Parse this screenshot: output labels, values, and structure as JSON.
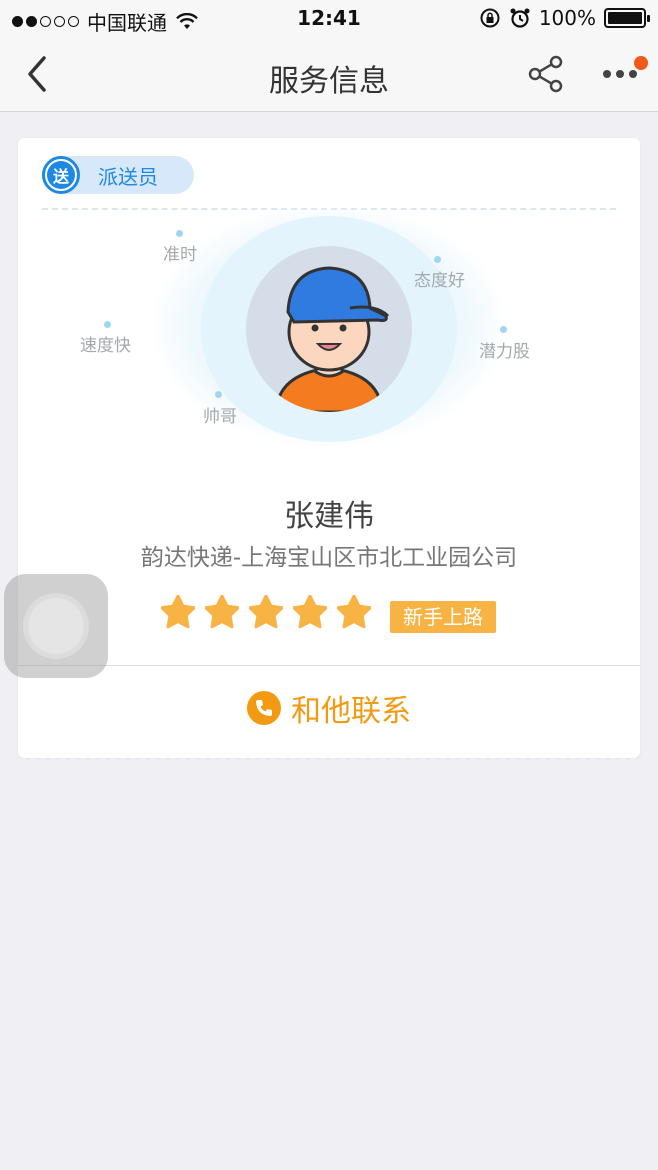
{
  "status_bar": {
    "carrier": "中国联通",
    "time": "12:41",
    "battery": "100%",
    "signal_strength": 2
  },
  "nav": {
    "title": "服务信息",
    "back_icon": "chevron-left-icon",
    "share_icon": "share-icon",
    "more_icon": "more-icon"
  },
  "card": {
    "role_tag": {
      "icon_text": "送",
      "label": "派送员"
    },
    "tags": [
      "准时",
      "态度好",
      "速度快",
      "潜力股",
      "帅哥"
    ],
    "name": "张建伟",
    "company": "韵达快递-上海宝山区市北工业园公司",
    "rating": 5,
    "level": "新手上路",
    "contact_label": "和他联系"
  },
  "colors": {
    "accent_blue": "#1e88e5",
    "accent_orange": "#f29a12",
    "badge": "#f7b343",
    "notification_dot": "#f25a1a"
  }
}
